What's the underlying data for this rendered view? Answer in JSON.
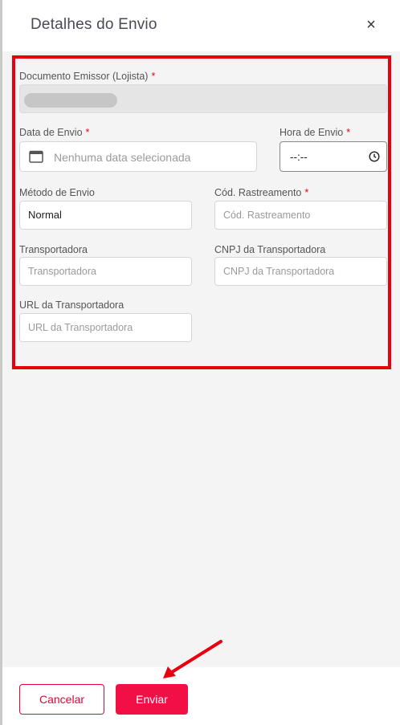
{
  "dialog": {
    "title": "Detalhes do Envio",
    "close_icon": "×"
  },
  "form": {
    "emissor": {
      "label": "Documento Emissor (Lojista)",
      "required": "*"
    },
    "data_envio": {
      "label": "Data de Envio",
      "required": "*",
      "placeholder": "Nenhuma data selecionada"
    },
    "hora_envio": {
      "label": "Hora de Envio",
      "required": "*",
      "value": "--:--"
    },
    "metodo_envio": {
      "label": "Método de Envio",
      "value": "Normal"
    },
    "cod_rastreamento": {
      "label": "Cód. Rastreamento",
      "required": "*",
      "placeholder": "Cód. Rastreamento"
    },
    "transportadora": {
      "label": "Transportadora",
      "placeholder": "Transportadora"
    },
    "cnpj_transportadora": {
      "label": "CNPJ da Transportadora",
      "placeholder": "CNPJ da Transportadora"
    },
    "url_transportadora": {
      "label": "URL da Transportadora",
      "placeholder": "URL da Transportadora"
    }
  },
  "footer": {
    "cancel_label": "Cancelar",
    "send_label": "Enviar"
  },
  "colors": {
    "accent": "#f20f46",
    "highlight_border": "#e8000f",
    "arrow": "#e8000f"
  }
}
